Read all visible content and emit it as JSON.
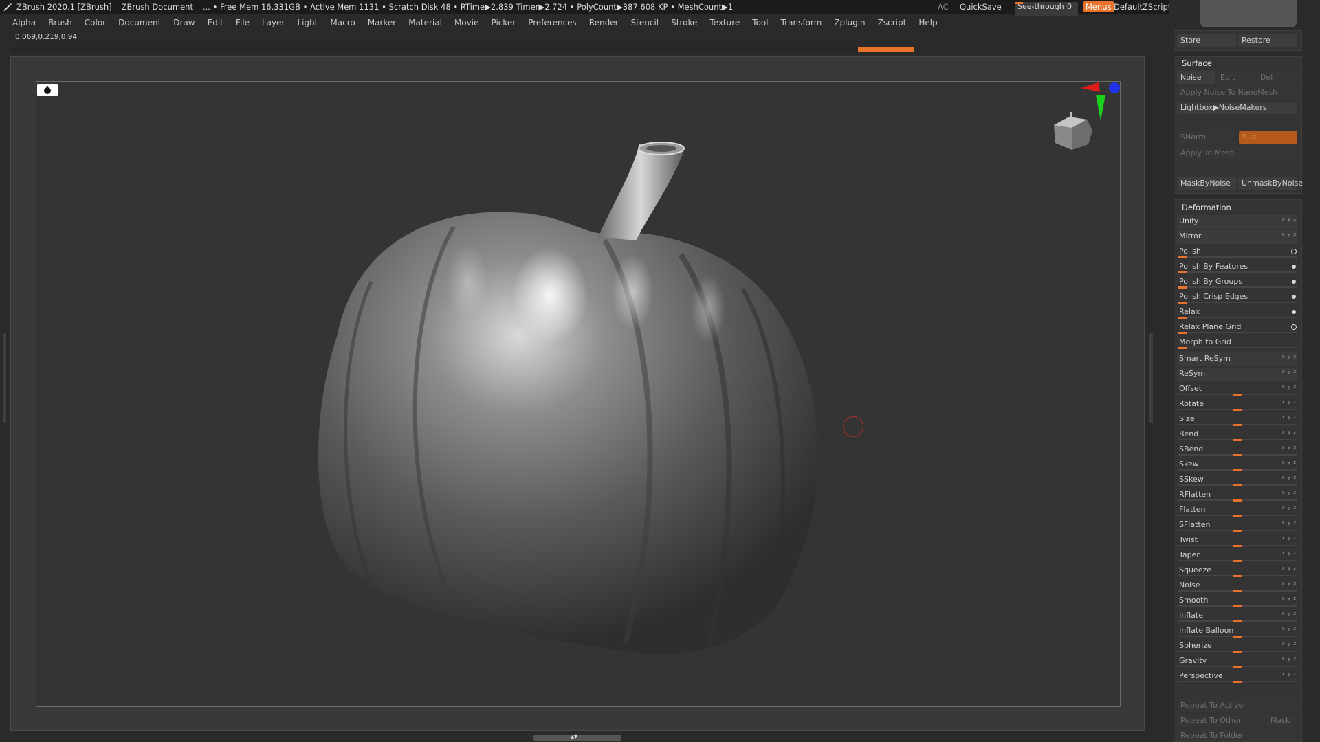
{
  "titlebar": {
    "app": "ZBrush 2020.1 [ZBrush]",
    "document": "ZBrush Document",
    "stats": "... • Free Mem 16.331GB • Active Mem 1131 • Scratch Disk 48 •  RTime▶2.839 Timer▶2.724 • PolyCount▶387.608 KP  • MeshCount▶1",
    "ac": "AC",
    "quicksave": "QuickSave",
    "see_through_label": "See-through",
    "see_through_value": "0",
    "menus": "Menus",
    "default_zscript": "DefaultZScript"
  },
  "menubar": {
    "items": [
      "Alpha",
      "Brush",
      "Color",
      "Document",
      "Draw",
      "Edit",
      "File",
      "Layer",
      "Light",
      "Macro",
      "Marker",
      "Material",
      "Movie",
      "Picker",
      "Preferences",
      "Render",
      "Stencil",
      "Stroke",
      "Texture",
      "Tool",
      "Transform",
      "Zplugin",
      "Zscript",
      "Help"
    ]
  },
  "coords": "0.069,0.219,0.94",
  "right_panel": {
    "store": "Store",
    "restore": "Restore",
    "surface": {
      "title": "Surface",
      "noise": "Noise",
      "edit": "Edit",
      "del": "Del",
      "apply_noise_nanomesh": "Apply Noise To NanoMesh",
      "lightbox_noisemakers": "Lightbox▶NoiseMakers",
      "snorm": "SNorm",
      "suv": "Suv",
      "apply_to_mesh": "Apply To Mesh",
      "mask_by_noise": "MaskByNoise",
      "unmask_by_noise": "UnmaskByNoise"
    },
    "deformation": {
      "title": "Deformation",
      "items": [
        "Unify",
        "Mirror",
        "Polish",
        "Polish By Features",
        "Polish By Groups",
        "Polish Crisp Edges",
        "Relax",
        "Relax Plane Grid",
        "Morph to Grid",
        "Smart ReSym",
        "ReSym",
        "Offset",
        "Rotate",
        "Size",
        "Bend",
        "SBend",
        "Skew",
        "SSkew",
        "RFlatten",
        "Flatten",
        "SFlatten",
        "Twist",
        "Taper",
        "Squeeze",
        "Noise",
        "Smooth",
        "Inflate",
        "Inflate Balloon",
        "Spherize",
        "Gravity",
        "Perspective"
      ],
      "xyz": "x y z"
    },
    "repeat": {
      "to_active": "Repeat To Active",
      "to_other": "Repeat To Other",
      "mask": "Mask",
      "to_folder": "Repeat To Folder"
    }
  },
  "colors": {
    "accent": "#e8722a",
    "background": "#2a2a2a",
    "viewport": "#343434"
  }
}
